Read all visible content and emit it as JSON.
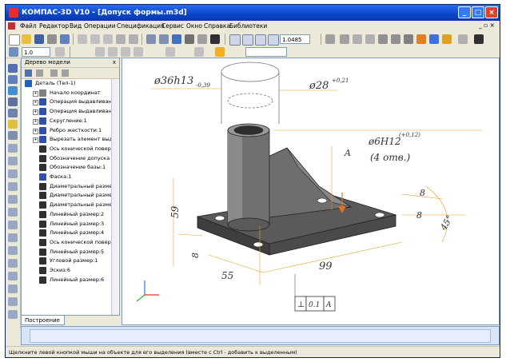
{
  "window": {
    "title": "КОМПАС-3D V10 - [Допуск формы.m3d]"
  },
  "menu": [
    "Файл",
    "Редактор",
    "Вид",
    "Операции",
    "Спецификация",
    "Сервис",
    "Окно",
    "Справка",
    "Библиотеки"
  ],
  "toolbar": {
    "scale_value": "1.0485",
    "step_value": "1.0"
  },
  "tree": {
    "title": "Дерево модели",
    "close": "x",
    "items": [
      {
        "label": "Деталь (Тел-1)",
        "color": "#2060c0"
      },
      {
        "label": "Начало координат",
        "color": "#808080"
      },
      {
        "label": "Операция выдавливания",
        "color": "#3050b0"
      },
      {
        "label": "Операция выдавливания",
        "color": "#3050b0"
      },
      {
        "label": "Скругление:1",
        "color": "#3050b0"
      },
      {
        "label": "Ребро жесткости:1",
        "color": "#3050b0"
      },
      {
        "label": "Вырезать элемент выдавливания",
        "color": "#3050b0"
      },
      {
        "label": "Ось конической поверхности",
        "color": "#303030"
      },
      {
        "label": "Обозначение допуска формы",
        "color": "#303030"
      },
      {
        "label": "Обозначение базы:1",
        "color": "#303030"
      },
      {
        "label": "Фаска:1",
        "color": "#3050b0"
      },
      {
        "label": "Диаметральный размер",
        "color": "#303030"
      },
      {
        "label": "Диаметральный размер",
        "color": "#303030"
      },
      {
        "label": "Диаметральный размер",
        "color": "#303030"
      },
      {
        "label": "Линейный размер:2",
        "color": "#303030"
      },
      {
        "label": "Линейный размер:3",
        "color": "#303030"
      },
      {
        "label": "Линейный размер:4",
        "color": "#303030"
      },
      {
        "label": "Ось конической поверхности",
        "color": "#303030"
      },
      {
        "label": "Линейный размер:5",
        "color": "#303030"
      },
      {
        "label": "Угловой размер:1",
        "color": "#303030"
      },
      {
        "label": "Эскиз:6",
        "color": "#303030"
      },
      {
        "label": "Линейный размер:6",
        "color": "#303030"
      }
    ],
    "tab_label": "Построение"
  },
  "drawing": {
    "dim_top": "ø36h13",
    "dim_top_tol": "-0,39",
    "dim_inner": "ø28",
    "dim_inner_tol": "+0,21",
    "dim_hole": "ø6H12",
    "dim_hole_tol": "(+0,12)",
    "dim_hole_count": "(4 отв.)",
    "datum": "A",
    "dim_height": "59",
    "dim_base": "8",
    "dim_width": "55",
    "dim_length": "99",
    "dim_chamfer_a": "8",
    "dim_chamfer_b": "8",
    "dim_angle": "45°",
    "tolerance_frame": [
      "⊥",
      "0.1",
      "A"
    ]
  },
  "status": {
    "text": "Щелкните левой кнопкой мыши на объекте для его выделения (вместе с Ctrl - добавить к выделенным)"
  }
}
